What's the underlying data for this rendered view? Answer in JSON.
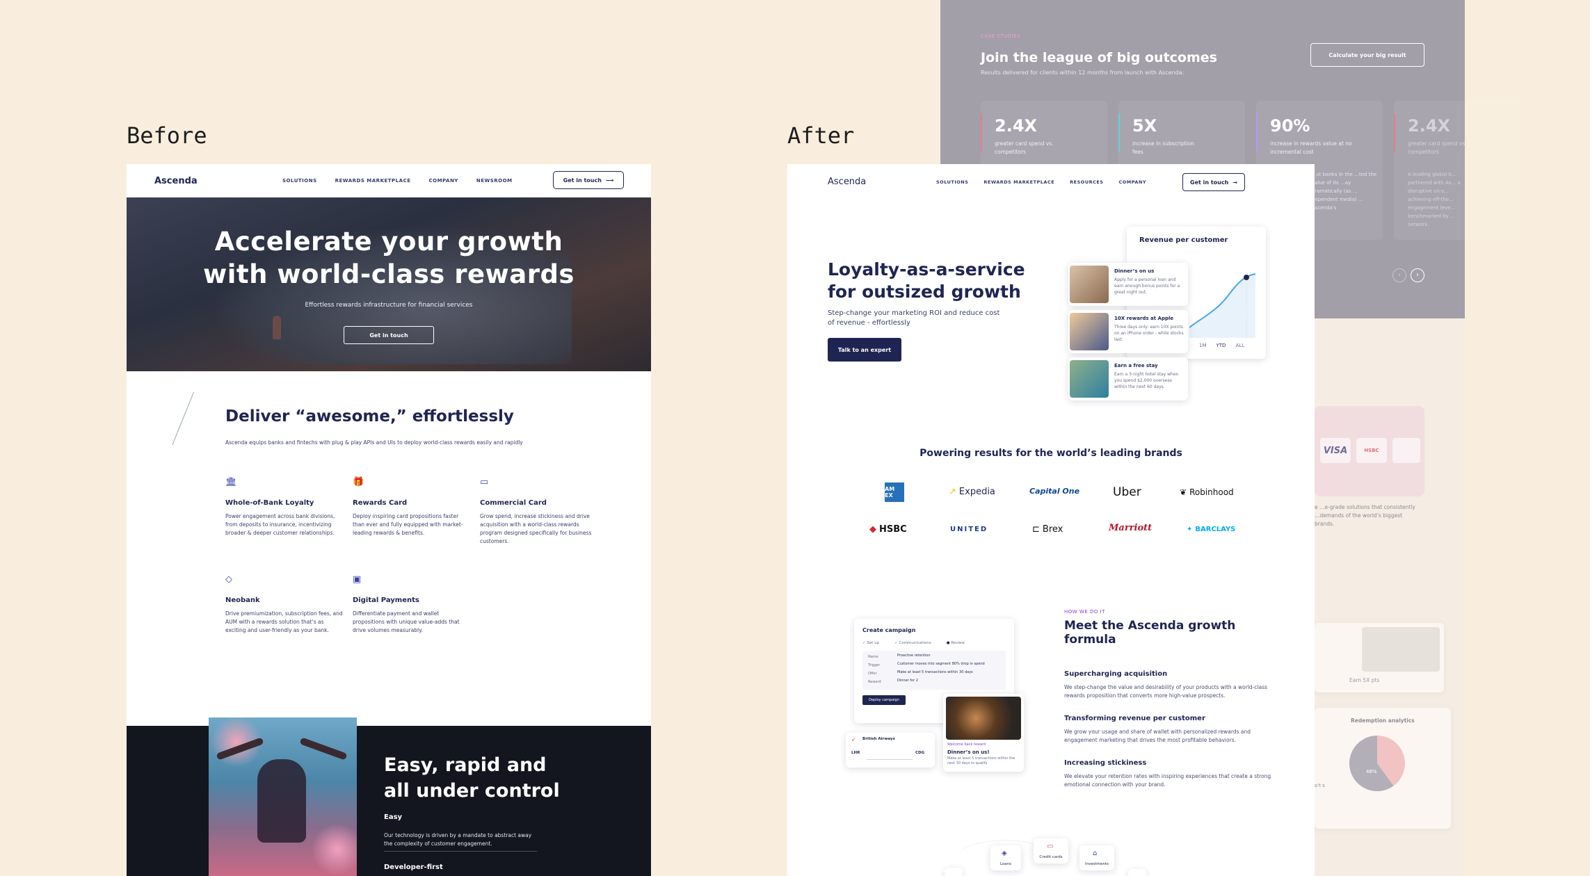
{
  "captions": {
    "before": "Before",
    "after": "After"
  },
  "before": {
    "logo": "Ascenda",
    "nav": [
      "SOLUTIONS",
      "REWARDS MARKETPLACE",
      "COMPANY",
      "NEWSROOM"
    ],
    "cta": "Get in touch",
    "hero_title_1": "Accelerate your growth",
    "hero_title_2": "with world-class rewards",
    "hero_sub": "Effortless rewards infrastructure for financial services",
    "hero_btn": "Get in touch",
    "section_title": "Deliver “awesome,” effortlessly",
    "section_sub": "Ascenda equips banks and fintechs with plug & play APIs and UIs to deploy world-class rewards easily and rapidly",
    "features": [
      {
        "icon": "bank-icon",
        "glyph": "🏛",
        "title": "Whole-of-Bank Loyalty",
        "text": "Power engagement across bank divisions, from deposits to insurance, incentivizing broader & deeper customer relationships."
      },
      {
        "icon": "gift-icon",
        "glyph": "🎁",
        "title": "Rewards Card",
        "text": "Deploy inspiring card propositions faster than ever and fully equipped with market-leading rewards & benefits."
      },
      {
        "icon": "card-icon",
        "glyph": "▭",
        "title": "Commercial Card",
        "text": "Grow spend, increase stickiness and drive acquisition with a world-class rewards program designed specifically for business customers."
      },
      {
        "icon": "diamond-icon",
        "glyph": "◇",
        "title": "Neobank",
        "text": "Drive premiumization, subscription fees, and AUM with a rewards solution that’s as exciting and user-friendly as your bank."
      },
      {
        "icon": "wallet-icon",
        "glyph": "▣",
        "title": "Digital Payments",
        "text": "Differentiate payment and wallet propositions with unique value-adds that drive volumes measurably."
      }
    ],
    "dark_title_1": "Easy, rapid and",
    "dark_title_2": "all under control",
    "dark_h1": "Easy",
    "dark_p1": "Our technology is driven by a mandate to abstract away the complexity of customer engagement.",
    "dark_h2": "Developer-first"
  },
  "overlay": {
    "kicker": "CASE STUDIES",
    "title": "Join the league of big outcomes",
    "sub": "Results delivered for clients within 12 months from launch with Ascenda:",
    "btn": "Calculate your big result",
    "stats": [
      {
        "value": "2.4X",
        "desc": "greater card spend vs. competitors",
        "color": "#e77b8e"
      },
      {
        "value": "5X",
        "desc": "increase in subscription fees",
        "color": "#5fd3d6"
      },
      {
        "value": "90%",
        "desc": "increase in rewards value at no incremental cost",
        "color": "#b29cf2"
      },
      {
        "value": "2.4X",
        "desc": "greater card spend vs. competitors",
        "color": "#e77b8e"
      }
    ],
    "stat3_body": "…st banks in the …ted the value of its …ay dramatically (as …dependent media) …Ascenda's",
    "stat4_body": "A leading global b… partnered with As… a disruptive on-s… achieving eff-the… engagement leve… benchmarked by … network.",
    "logos": [
      "VISA",
      "HSBC"
    ],
    "side_text": "e …e-grade solutions that consistently …demands of the world’s biggest brands.",
    "earn": "Earn 5X pts",
    "analytics": "Redemption analytics",
    "pie_pct": "46%",
    "side_frag": "o't s"
  },
  "after": {
    "logo": "Ascenda",
    "nav": [
      "SOLUTIONS",
      "REWARDS MARKETPLACE",
      "RESOURCES",
      "COMPANY"
    ],
    "cta": "Get in touch",
    "hero_title_1": "Loyalty-as-a-service",
    "hero_title_2": "for outsized growth",
    "hero_sub": "Step-change your marketing ROI and reduce cost of revenue - effortlessly",
    "hero_btn": "Talk to an expert",
    "revenue_title": "Revenue per customer",
    "revenue_ticks": [
      "1M",
      "YTD",
      "ALL"
    ],
    "offers": [
      {
        "title": "Dinner’s on us",
        "text": "Apply for a personal loan and earn enough bonus points for a great night out."
      },
      {
        "title": "10X rewards at Apple",
        "text": "Three days only: earn 10X points on an iPhone order - while stocks last."
      },
      {
        "title": "Earn a free stay",
        "text": "Earn a 3-night hotel stay when you spend $2,000 overseas within the next 60 days."
      }
    ],
    "brands_title": "Powering results for the world’s leading brands",
    "brands": [
      "AM EX",
      "Expedia",
      "Capital One",
      "Uber",
      "Robinhood",
      "HSBC",
      "UNITED",
      "Brex",
      "Marriott",
      "BARCLAYS"
    ],
    "how_kicker": "HOW WE DO IT",
    "how_title_1": "Meet the Ascenda growth",
    "how_title_2": "formula",
    "how": [
      {
        "title": "Supercharging acquisition",
        "text": "We step-change the value and desirability of your products with a world-class rewards proposition that converts more high-value prospects."
      },
      {
        "title": "Transforming revenue per customer",
        "text": "We grow your usage and share of wallet with personalized rewards and engagement marketing that drives the most profitable behaviors."
      },
      {
        "title": "Increasing stickiness",
        "text": "We elevate your retention rates with inspiring experiences that create a strong emotional connection with your brand."
      }
    ],
    "campaign_title": "Create campaign",
    "campaign_steps": [
      "Set up",
      "Communications",
      "Review"
    ],
    "campaign_rows": [
      {
        "k": "Name",
        "v": "Proactive retention"
      },
      {
        "k": "Trigger",
        "v": "Customer moves into segment 80% drop in spend"
      },
      {
        "k": "Offer",
        "v": "Make at least 5 transactions within 30 days"
      },
      {
        "k": "Reward",
        "v": "Dinner for 2"
      }
    ],
    "campaign_btn": "Deploy campaign",
    "flight_airline": "British Airways",
    "flight_code1": "LHR",
    "flight_code2": "CDG",
    "dinner_badge": "Welcome back reward",
    "dinner_title": "Dinner’s on us!",
    "dinner_text": "Make at least 5 transactions within the next 30 days to qualify",
    "bottom_icons": [
      "Loans",
      "Credit cards",
      "Investments"
    ]
  }
}
